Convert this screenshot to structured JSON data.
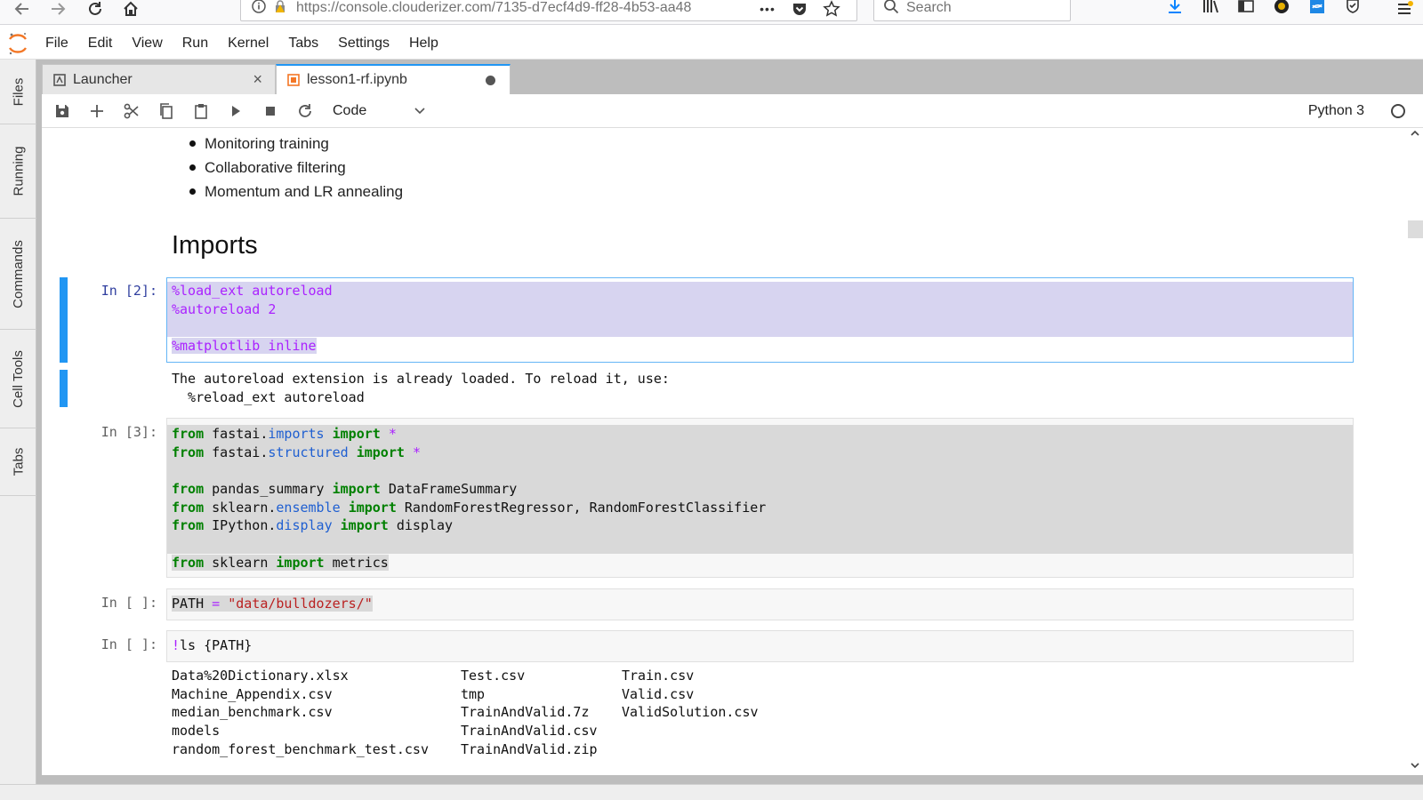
{
  "browser": {
    "url": "https://console.clouderizer.com/7135-d7ecf4d9-ff28-4b53-aa48",
    "url_host": "clouderizer.com",
    "search_placeholder": "Search",
    "overflow_label": "•••"
  },
  "menu": [
    "File",
    "Edit",
    "View",
    "Run",
    "Kernel",
    "Tabs",
    "Settings",
    "Help"
  ],
  "sidebar": [
    "Files",
    "Running",
    "Commands",
    "Cell Tools",
    "Tabs"
  ],
  "tabs": [
    {
      "label": "Launcher",
      "close": "×"
    },
    {
      "label": "lesson1-rf.ipynb"
    }
  ],
  "toolbar": {
    "cell_type": "Code",
    "kernel": "Python 3"
  },
  "markdown": {
    "bullets": [
      "Monitoring training",
      "Collaborative filtering",
      "Momentum and LR annealing"
    ],
    "heading": "Imports"
  },
  "cells": {
    "c1": {
      "prompt": "In [2]:",
      "lines": [
        "%load_ext autoreload",
        "%autoreload 2",
        "",
        "%matplotlib inline"
      ],
      "output": [
        "The autoreload extension is already loaded. To reload it, use:",
        "  %reload_ext autoreload"
      ]
    },
    "c2": {
      "prompt": "In [3]:",
      "lines": [
        "from fastai.imports import *",
        "from fastai.structured import *",
        "",
        "from pandas_summary import DataFrameSummary",
        "from sklearn.ensemble import RandomForestRegressor, RandomForestClassifier",
        "from IPython.display import display",
        "",
        "from sklearn import metrics"
      ]
    },
    "c3": {
      "prompt": "In [ ]:",
      "line": "PATH = \"data/bulldozers/\""
    },
    "c4": {
      "prompt": "In [ ]:",
      "line": "!ls {PATH}",
      "output": [
        "Data%20Dictionary.xlsx",
        "Test.csv",
        "Train.csv",
        "Machine_Appendix.csv",
        "tmp",
        "Valid.csv",
        "median_benchmark.csv",
        "TrainAndValid.7z",
        "ValidSolution.csv",
        "models",
        "TrainAndValid.csv",
        "",
        "random_forest_benchmark_test.csv",
        "TrainAndValid.zip",
        ""
      ]
    }
  }
}
